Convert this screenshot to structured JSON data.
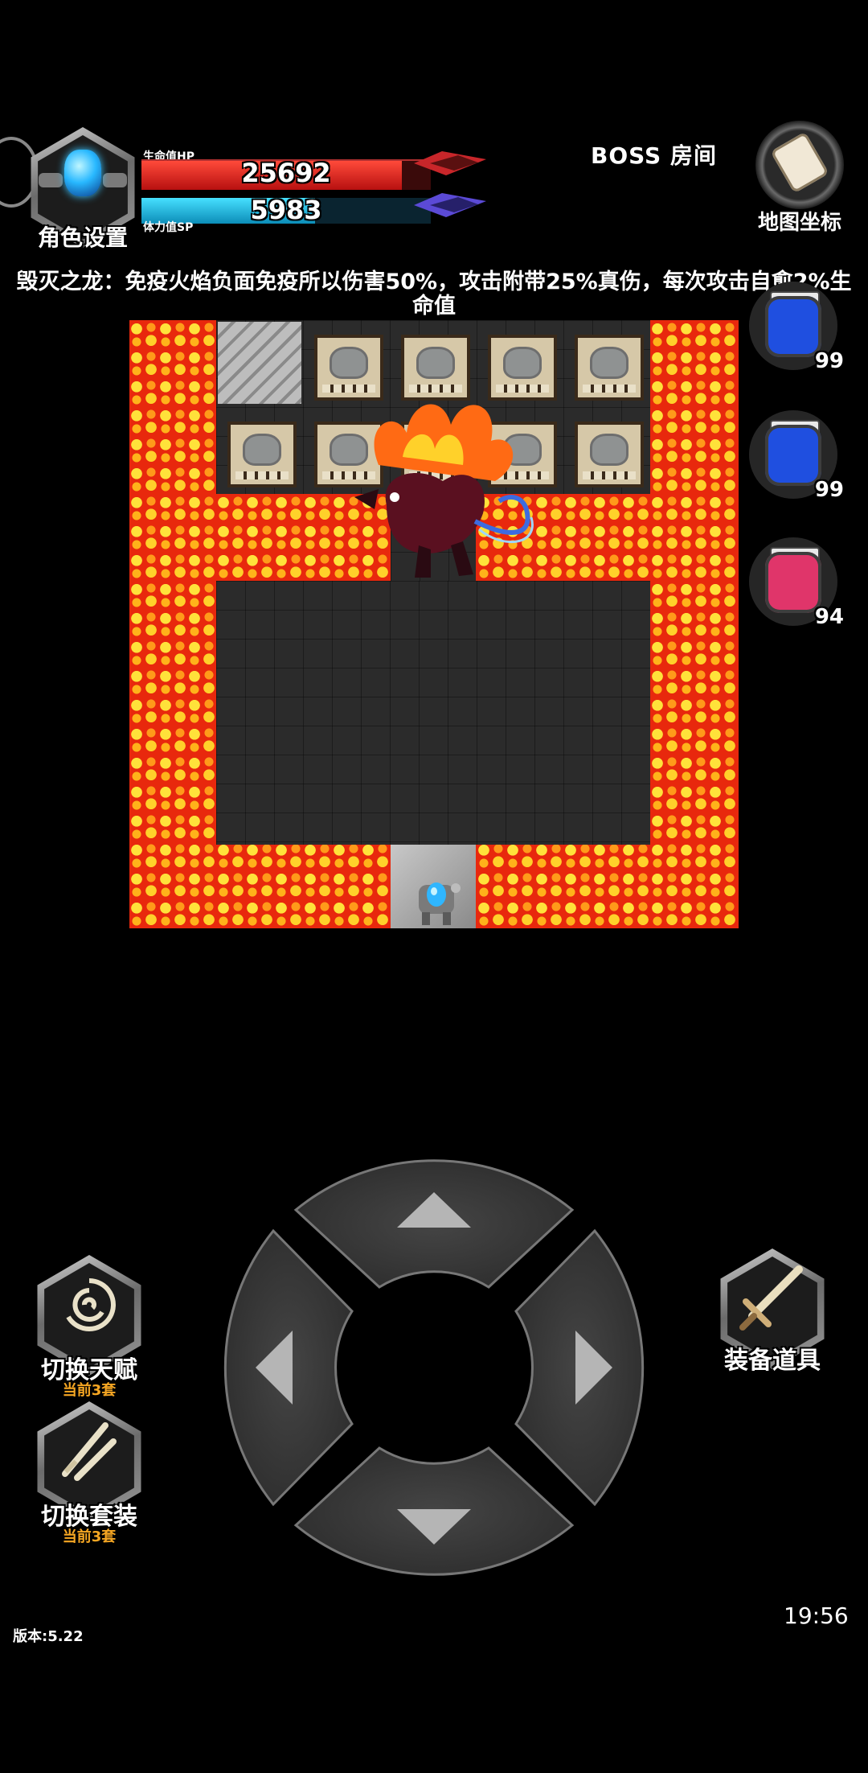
{
  "character_button": {
    "label": "角色设置"
  },
  "hp_bar": {
    "label": "生命值HP",
    "value": "25692",
    "fill_fraction": 0.9
  },
  "sp_bar": {
    "label": "体力值SP",
    "value": "5983",
    "fill_fraction": 0.6
  },
  "room": {
    "label": "BOSS  房间"
  },
  "map_button": {
    "label": "地图坐标"
  },
  "boss_description": "毁灭之龙：免疫火焰负面免疫所以伤害50%，攻击附带25%真伤，每次攻击自愈2%生命值",
  "potions": [
    {
      "color": "#1f4fe0",
      "count": "99",
      "icon": "blue-potion-icon"
    },
    {
      "color": "#1f4fe0",
      "count": "99",
      "icon": "blue-potion-icon"
    },
    {
      "color": "#e0356a",
      "count": "94",
      "icon": "red-potion-icon"
    }
  ],
  "skills": {
    "talent": {
      "label": "切换天赋",
      "sub": "当前3套",
      "icon": "swirl-icon"
    },
    "outfit": {
      "label": "切换套装",
      "sub": "当前3套",
      "icon": "crossed-swords-icon"
    },
    "equipment": {
      "label": "装备道具",
      "icon": "sword-icon"
    }
  },
  "version": "版本:5.22",
  "clock": "19:56",
  "colors": {
    "lava": "#e8280d",
    "hp": "#d41e1e",
    "sp": "#1fb6e6",
    "sub_text": "#f5a623"
  }
}
